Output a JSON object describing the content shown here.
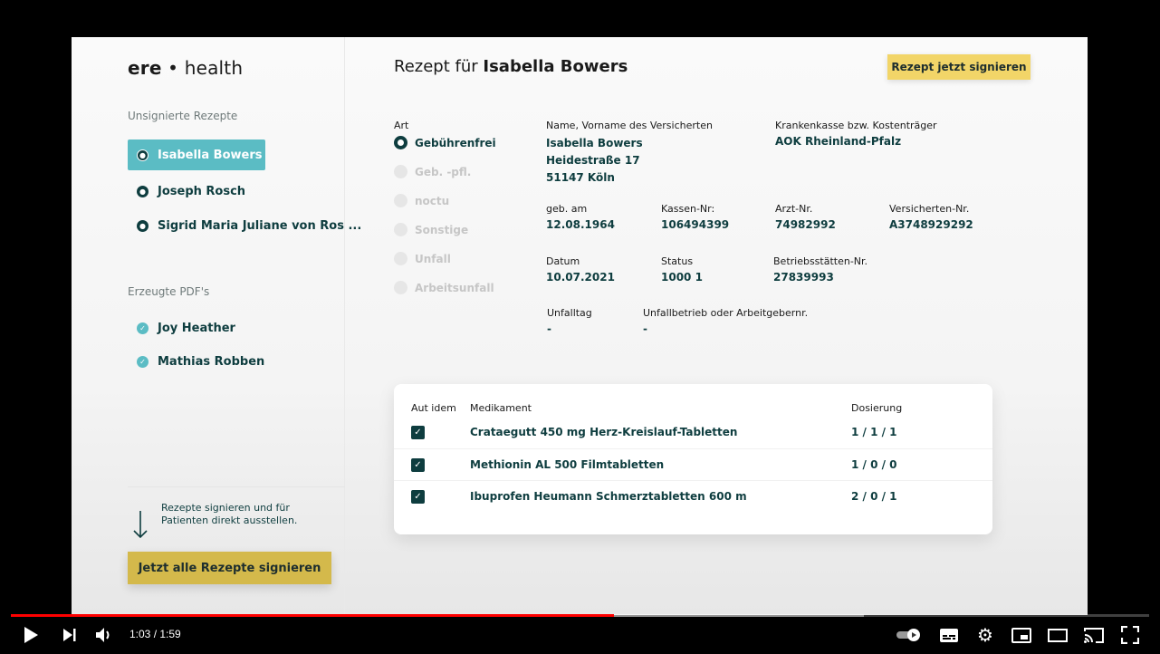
{
  "app": {
    "logo_left": "ere",
    "logo_sep": "•",
    "logo_right": "health"
  },
  "sidebar": {
    "unsigned_label": "Unsignierte Rezepte",
    "unsigned": [
      {
        "name": "Isabella Bowers"
      },
      {
        "name": "Joseph Rosch"
      },
      {
        "name": "Sigrid Maria Juliane von Ros ..."
      }
    ],
    "pdf_label": "Erzeugte PDF's",
    "pdfs": [
      {
        "name": "Joy Heather"
      },
      {
        "name": "Mathias Robben"
      }
    ],
    "hint": "Rezepte signieren und für Patienten direkt ausstellen.",
    "sign_all_label": "Jetzt alle Rezepte signieren"
  },
  "header": {
    "title_prefix": "Rezept für",
    "title_name": "Isabella Bowers",
    "sign_now_label": "Rezept jetzt signieren"
  },
  "form": {
    "art_label": "Art",
    "art_options": [
      "Gebührenfrei",
      "Geb. -pfl.",
      "noctu",
      "Sonstige",
      "Unfall",
      "Arbeitsunfall"
    ],
    "art_selected": "Gebührenfrei",
    "insured_label": "Name, Vorname des Versicherten",
    "insured_name": "Isabella Bowers",
    "insured_street": "Heidestraße 17",
    "insured_city": "51147 Köln",
    "insurer_label": "Krankenkasse bzw. Kostenträger",
    "insurer_value": "AOK Rheinland-Pfalz",
    "dob_label": "geb. am",
    "dob_value": "12.08.1964",
    "kassen_label": "Kassen-Nr:",
    "kassen_value": "106494399",
    "arzt_label": "Arzt-Nr.",
    "arzt_value": "74982992",
    "versicherten_label": "Versicherten-Nr.",
    "versicherten_value": "A3748929292",
    "datum_label": "Datum",
    "datum_value": "10.07.2021",
    "status_label": "Status",
    "status_value": "1000 1",
    "bs_label": "Betriebsstätten-Nr.",
    "bs_value": "27839993",
    "unfalltag_label": "Unfalltag",
    "unfalltag_value": "-",
    "unfallbetrieb_label": "Unfallbetrieb oder Arbeitgebernr.",
    "unfallbetrieb_value": "-"
  },
  "medications": {
    "headers": {
      "aut_idem": "Aut idem",
      "name": "Medikament",
      "dose": "Dosierung"
    },
    "rows": [
      {
        "aut_idem": true,
        "name": "Crataegutt 450 mg Herz-Kreislauf-Tabletten",
        "dose": "1 / 1 / 1"
      },
      {
        "aut_idem": true,
        "name": "Methionin AL 500 Filmtabletten",
        "dose": "1 / 0 / 0"
      },
      {
        "aut_idem": true,
        "name": "Ibuprofen Heumann Schmerztabletten 600 m",
        "dose": "2 / 0 / 1"
      }
    ]
  },
  "player": {
    "time": "1:03 / 1:59",
    "progress_fraction": 0.53,
    "icons": [
      "play-icon",
      "next-icon",
      "volume-icon",
      "autoplay-toggle-icon",
      "subtitles-icon",
      "settings-icon",
      "miniplayer-icon",
      "theater-icon",
      "cast-icon",
      "fullscreen-icon"
    ]
  }
}
